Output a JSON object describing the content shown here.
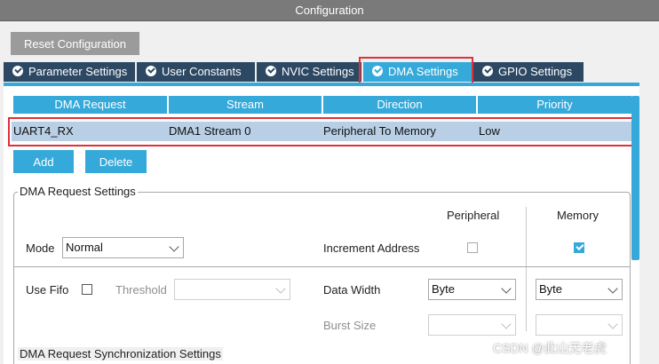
{
  "window": {
    "title": "Configuration"
  },
  "toolbar": {
    "reset_label": "Reset Configuration"
  },
  "tabs": [
    {
      "label": "Parameter Settings",
      "active": false
    },
    {
      "label": "User Constants",
      "active": false
    },
    {
      "label": "NVIC Settings",
      "active": false
    },
    {
      "label": "DMA Settings",
      "active": true
    },
    {
      "label": "GPIO Settings",
      "active": false
    }
  ],
  "dma_table": {
    "columns": [
      "DMA Request",
      "Stream",
      "Direction",
      "Priority"
    ],
    "rows": [
      [
        "UART4_RX",
        "DMA1 Stream 0",
        "Peripheral To Memory",
        "Low"
      ]
    ]
  },
  "actions": {
    "add_label": "Add",
    "delete_label": "Delete"
  },
  "request_settings": {
    "title": "DMA Request Settings",
    "peripheral_header": "Peripheral",
    "memory_header": "Memory",
    "mode_label": "Mode",
    "mode_value": "Normal",
    "increment_label": "Increment Address",
    "peripheral_increment": false,
    "memory_increment": true,
    "fifo_label": "Use Fifo",
    "fifo_checked": false,
    "threshold_label": "Threshold",
    "threshold_value": "",
    "data_width_label": "Data Width",
    "peripheral_data_width": "Byte",
    "memory_data_width": "Byte",
    "burst_label": "Burst Size",
    "peripheral_burst": "",
    "memory_burst": ""
  },
  "sync_settings": {
    "title": "DMA Request Synchronization Settings"
  },
  "watermark": "CSDN @此山无老虎",
  "colors": {
    "accent": "#35a9d9",
    "tab_dark": "#2c4863",
    "highlight": "#e0303a",
    "row_selected": "#b8cfe6"
  }
}
